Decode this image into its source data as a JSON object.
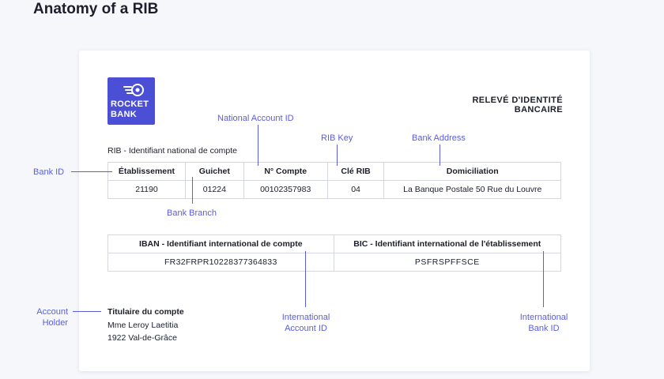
{
  "page_title": "Anatomy of a RIB",
  "logo": {
    "line1": "ROCKET",
    "line2": "BANK"
  },
  "document_title": "RELEVÉ D'IDENTITÉ BANCAIRE",
  "rib_section_label": "RIB - Identifiant national de compte",
  "rib_table": {
    "headers": [
      "Établissement",
      "Guichet",
      "N° Compte",
      "Clé RIB",
      "Domiciliation"
    ],
    "values": [
      "21190",
      "01224",
      "00102357983",
      "04",
      "La Banque Postale 50 Rue du Louvre"
    ]
  },
  "intl_table": {
    "headers": [
      "IBAN - Identifiant international de compte",
      "BIC - Identifiant international de l'établissement"
    ],
    "values": [
      "FR32FRPR10228377364833",
      "PSFRSPFFSCE"
    ]
  },
  "holder": {
    "title": "Titulaire du compte",
    "name": "Mme Leroy Laetitia",
    "address": "1922 Val-de-Grâce"
  },
  "annotations": {
    "bank_id": "Bank ID",
    "national_account_id": "National Account ID",
    "rib_key": "RIB Key",
    "bank_address": "Bank Address",
    "bank_branch": "Bank Branch",
    "account_holder_1": "Account",
    "account_holder_2": "Holder",
    "international_account_id_1": "International",
    "international_account_id_2": "Account ID",
    "international_bank_id_1": "International",
    "international_bank_id_2": "Bank ID"
  },
  "colors": {
    "accent": "#5a5ee0",
    "logo_bg": "#4b4fd6",
    "background": "#f6f7fb"
  }
}
